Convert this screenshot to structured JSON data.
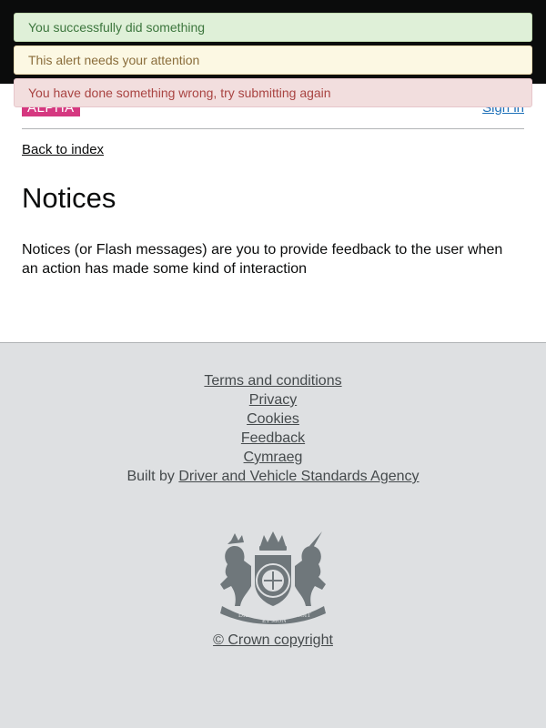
{
  "alerts": {
    "success": "You successfully did something",
    "warning": "This alert needs your attention",
    "danger": "You have done something wrong, try submitting again"
  },
  "header": {
    "phase_tag": "ALPHA",
    "sign_in": "Sign in"
  },
  "main": {
    "back_link": "Back to index",
    "title": "Notices",
    "body": "Notices (or Flash messages) are you to provide feedback to the user when an action has made some kind of interaction"
  },
  "footer": {
    "links": [
      "Terms and conditions",
      "Privacy",
      "Cookies",
      "Feedback",
      "Cymraeg"
    ],
    "built_by_prefix": "Built by",
    "built_by_link": "Driver and Vehicle Standards Agency",
    "crest_motto_1": "DIEU",
    "crest_motto_2": "ET MON",
    "crest_motto_3": "DROIT",
    "copyright": "© Crown copyright"
  },
  "colors": {
    "header": "#0b0c0c",
    "phase_tag": "#d53880",
    "link": "#1d70b8",
    "footer_bg": "#dee0e2",
    "crest": "#6f777b"
  }
}
